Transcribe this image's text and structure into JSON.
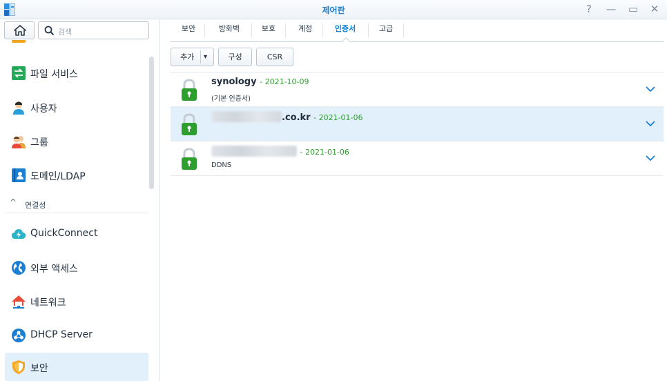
{
  "window": {
    "title": "제어판",
    "controls": {
      "help": "?",
      "minimize": "—",
      "maximize": "▭",
      "close": "✕"
    }
  },
  "sidebar": {
    "search_placeholder": "검색",
    "items": [
      {
        "label": "파일 서비스",
        "icon": "file-services-icon"
      },
      {
        "label": "사용자",
        "icon": "user-icon"
      },
      {
        "label": "그룹",
        "icon": "group-icon"
      },
      {
        "label": "도메인/LDAP",
        "icon": "domain-ldap-icon"
      }
    ],
    "section": {
      "label": "연결성",
      "caret": "^"
    },
    "connectivity_items": [
      {
        "label": "QuickConnect",
        "icon": "quickconnect-icon"
      },
      {
        "label": "외부 액세스",
        "icon": "external-access-icon"
      },
      {
        "label": "네트워크",
        "icon": "network-icon"
      },
      {
        "label": "DHCP Server",
        "icon": "dhcp-server-icon"
      },
      {
        "label": "보안",
        "icon": "security-shield-icon",
        "active": true
      }
    ]
  },
  "tabs": [
    {
      "label": "보안"
    },
    {
      "label": "방화벽"
    },
    {
      "label": "보호"
    },
    {
      "label": "계정"
    },
    {
      "label": "인증서",
      "active": true
    },
    {
      "label": "고급"
    }
  ],
  "toolbar": {
    "add_label": "추가",
    "add_dropdown": "▾",
    "configure_label": "구성",
    "csr_label": "CSR"
  },
  "certificates": [
    {
      "name": "synology",
      "date": "- 2021-10-09",
      "description": "(기본 인증서)"
    },
    {
      "name": ".co.kr",
      "date": "- 2021-01-06",
      "description": ""
    },
    {
      "name": "",
      "date": "- 2021-01-06",
      "description": "DDNS"
    }
  ],
  "colors": {
    "accent": "#0a82d6",
    "selected_row": "#e2f0fc",
    "lock_green": "#2e9e2e",
    "date_green": "#2e9e2e"
  }
}
